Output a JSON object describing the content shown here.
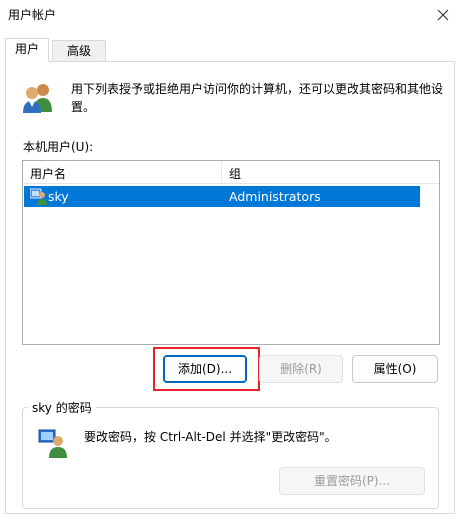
{
  "window": {
    "title": "用户帐户"
  },
  "tabs": [
    {
      "label": "用户",
      "active": true
    },
    {
      "label": "高级",
      "active": false
    }
  ],
  "intro": {
    "text": "用下列表授予或拒绝用户访问你的计算机，还可以更改其密码和其他设置。"
  },
  "users_list": {
    "label": "本机用户(U):",
    "columns": [
      "用户名",
      "组"
    ],
    "rows": [
      {
        "name": "sky",
        "group": "Administrators",
        "selected": true
      }
    ]
  },
  "buttons": {
    "add": "添加(D)...",
    "remove": "删除(R)",
    "properties": "属性(O)"
  },
  "password_section": {
    "title": "sky 的密码",
    "text": "要改密码，按 Ctrl-Alt-Del 并选择\"更改密码\"。",
    "reset_button": "重置密码(P)..."
  },
  "colors": {
    "selection": "#0078d7",
    "highlight_box": "#e3262a",
    "default_button_border": "#0067c0"
  },
  "icons": [
    "close-icon",
    "users-icon",
    "user-icon",
    "user-key-icon"
  ]
}
